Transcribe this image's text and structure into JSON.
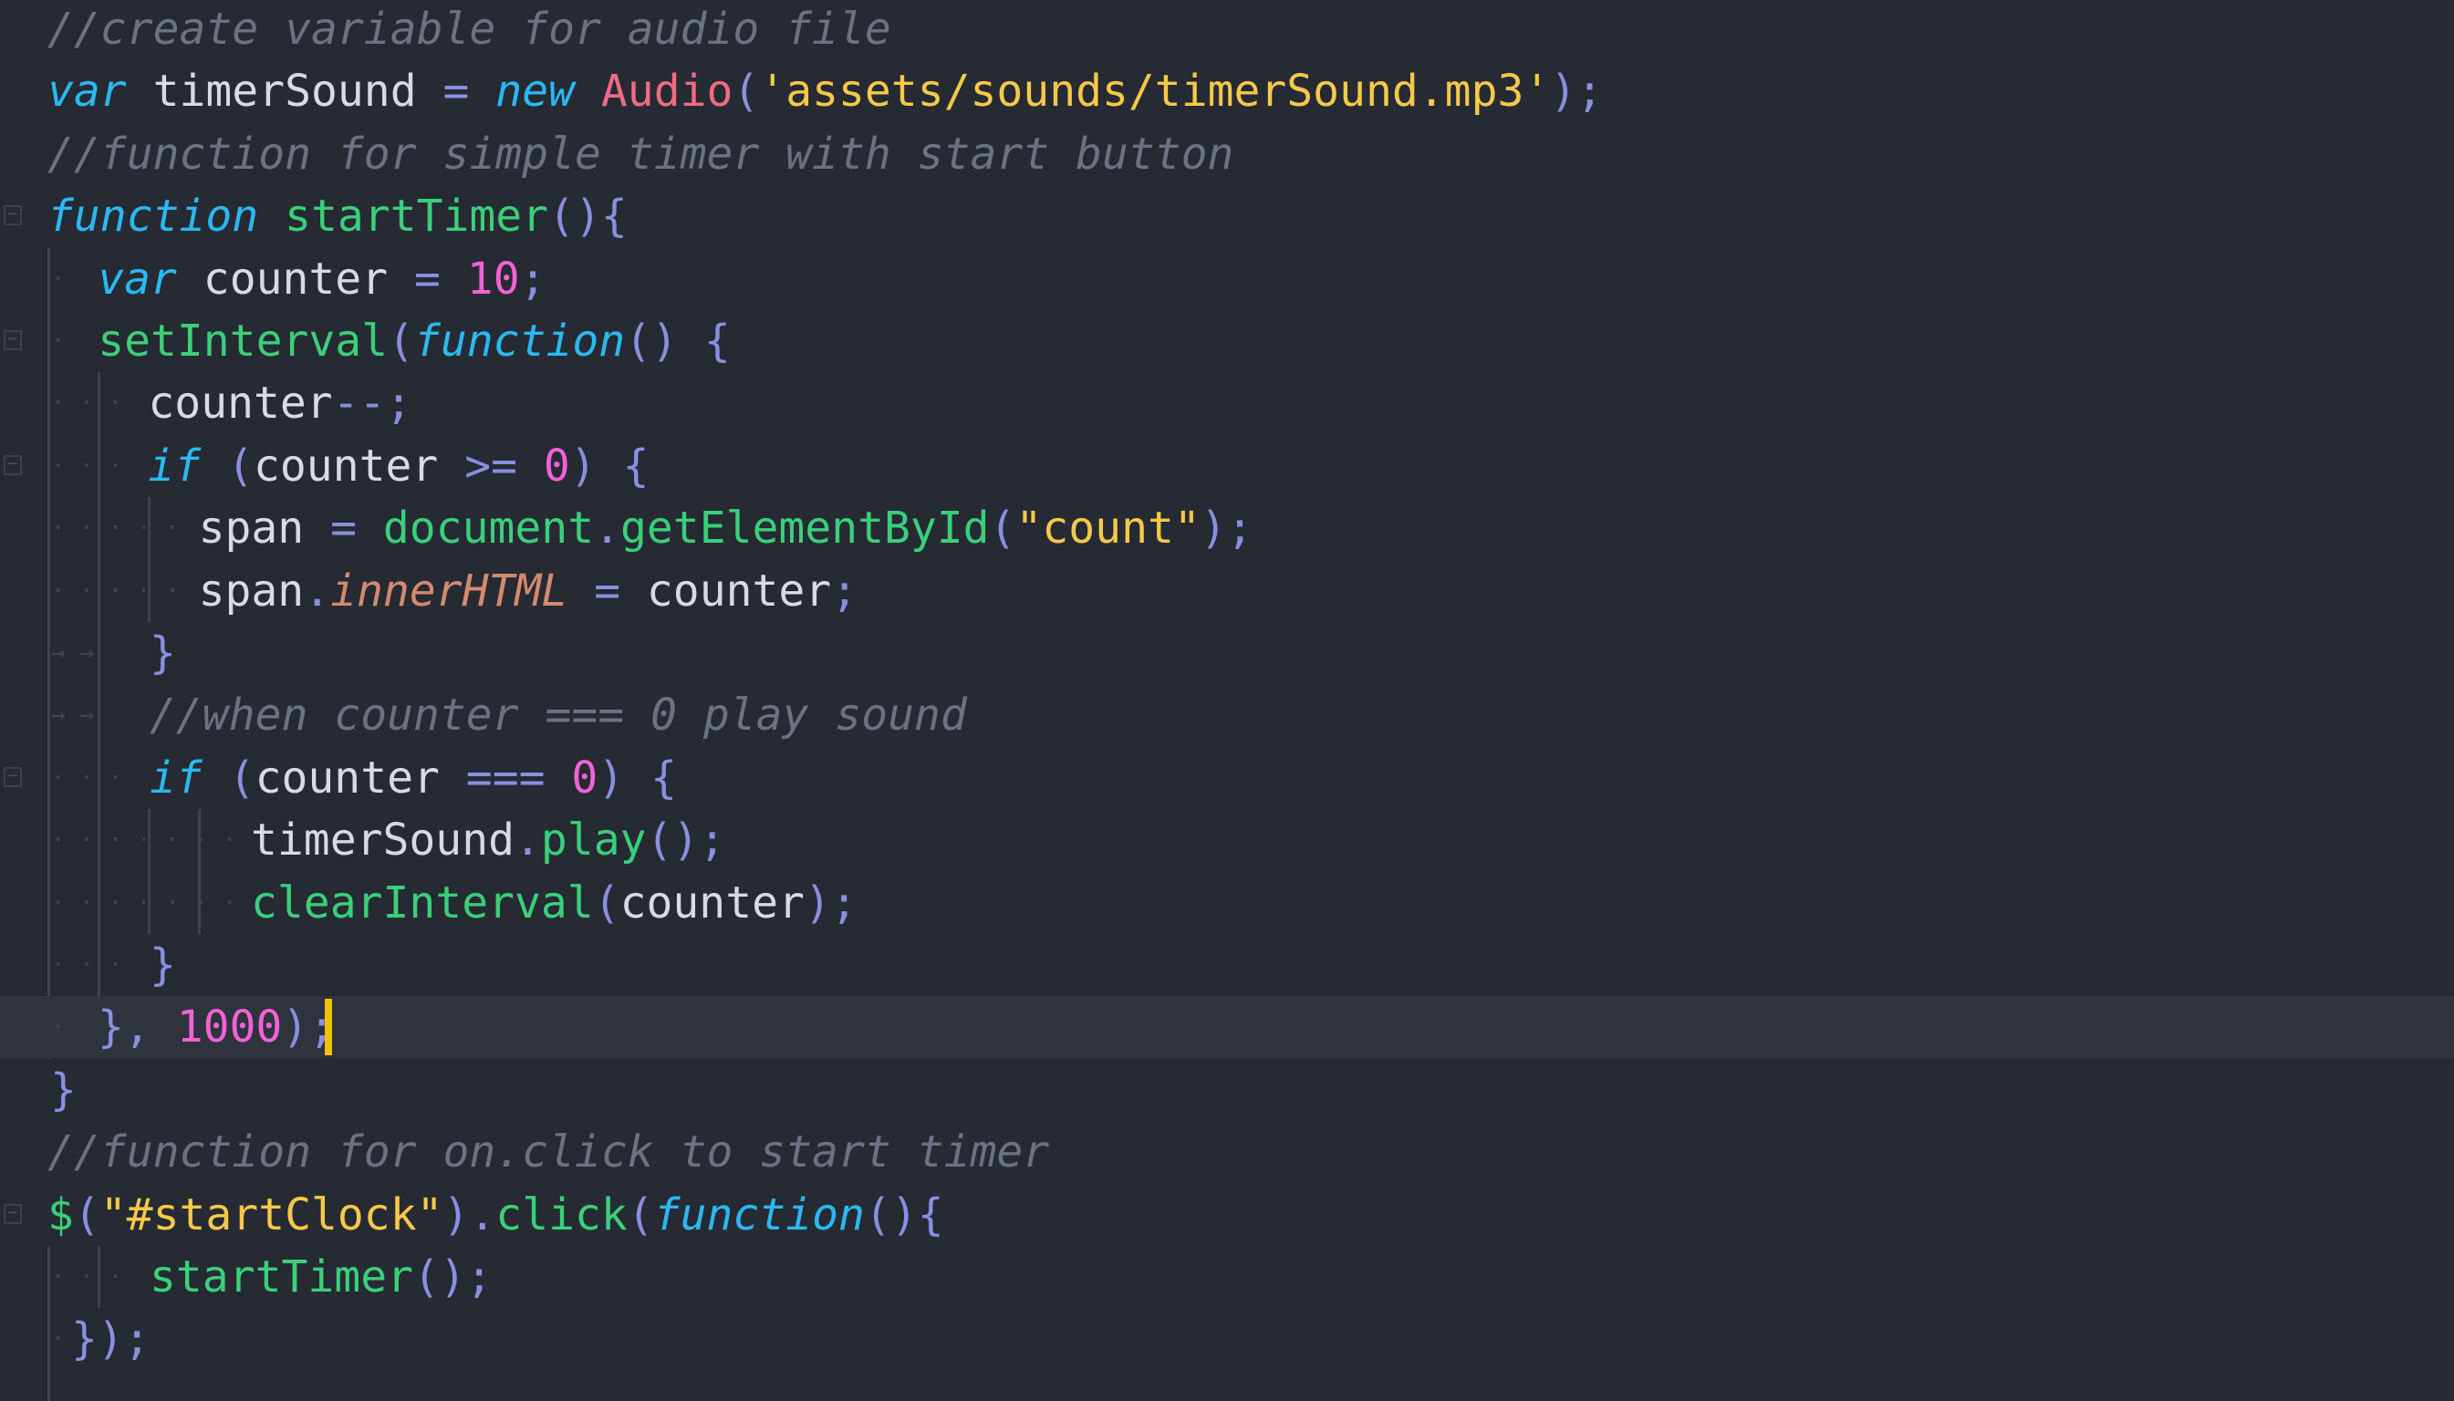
{
  "editor": {
    "language": "javascript",
    "theme_colors": {
      "background": "#262a33",
      "active_line": "#2e333d",
      "comment": "#6b7282",
      "keyword": "#2ab9f2",
      "function": "#3ad07a",
      "string": "#f7c948",
      "class": "#f16b84",
      "number": "#f262d6",
      "punctuation": "#8a8fe0",
      "property": "#d38a6f",
      "caret": "#f2c100"
    },
    "lines": [
      {
        "t": [
          [
            "cmt",
            "//create variable for audio file"
          ]
        ]
      },
      {
        "t": [
          [
            "kw",
            "var"
          ],
          [
            "id",
            " timerSound "
          ],
          [
            "op",
            "="
          ],
          [
            "id",
            " "
          ],
          [
            "kw",
            "new"
          ],
          [
            "id",
            " "
          ],
          [
            "cls",
            "Audio"
          ],
          [
            "pun",
            "("
          ],
          [
            "str",
            "'assets/sounds/timerSound.mp3'"
          ],
          [
            "pun",
            ");"
          ]
        ]
      },
      {
        "t": [
          [
            "cmt",
            "//function for simple timer with start button"
          ]
        ]
      },
      {
        "t": [
          [
            "kw",
            "function"
          ],
          [
            "id",
            " "
          ],
          [
            "fn",
            "startTimer"
          ],
          [
            "pun",
            "(){"
          ]
        ]
      },
      {
        "t": [
          [
            "kw",
            "var"
          ],
          [
            "id",
            " counter "
          ],
          [
            "op",
            "="
          ],
          [
            "id",
            " "
          ],
          [
            "num",
            "10"
          ],
          [
            "pun",
            ";"
          ]
        ]
      },
      {
        "t": [
          [
            "fn",
            "setInterval"
          ],
          [
            "pun",
            "("
          ],
          [
            "kw",
            "function"
          ],
          [
            "pun",
            "()"
          ],
          [
            "id",
            " "
          ],
          [
            "pun",
            "{"
          ]
        ]
      },
      {
        "t": [
          [
            "id",
            "counter"
          ],
          [
            "op",
            "--;"
          ]
        ]
      },
      {
        "t": [
          [
            "kw",
            "if"
          ],
          [
            "id",
            " "
          ],
          [
            "pun",
            "("
          ],
          [
            "id",
            "counter "
          ],
          [
            "op",
            ">="
          ],
          [
            "id",
            " "
          ],
          [
            "num",
            "0"
          ],
          [
            "pun",
            ")"
          ],
          [
            "id",
            " "
          ],
          [
            "pun",
            "{"
          ]
        ]
      },
      {
        "t": [
          [
            "id",
            "span "
          ],
          [
            "op",
            "="
          ],
          [
            "id",
            " "
          ],
          [
            "fn",
            "document"
          ],
          [
            "pun",
            "."
          ],
          [
            "fn",
            "getElementById"
          ],
          [
            "pun",
            "("
          ],
          [
            "str",
            "\"count\""
          ],
          [
            "pun",
            ");"
          ]
        ]
      },
      {
        "t": [
          [
            "id",
            "span"
          ],
          [
            "pun",
            "."
          ],
          [
            "prop",
            "innerHTML"
          ],
          [
            "id",
            " "
          ],
          [
            "op",
            "="
          ],
          [
            "id",
            " counter"
          ],
          [
            "pun",
            ";"
          ]
        ]
      },
      {
        "t": [
          [
            "pun",
            "}"
          ]
        ]
      },
      {
        "t": [
          [
            "cmt",
            "//when counter === 0 play sound"
          ]
        ]
      },
      {
        "t": [
          [
            "kw",
            "if"
          ],
          [
            "id",
            " "
          ],
          [
            "pun",
            "("
          ],
          [
            "id",
            "counter "
          ],
          [
            "op",
            "==="
          ],
          [
            "id",
            " "
          ],
          [
            "num",
            "0"
          ],
          [
            "pun",
            ")"
          ],
          [
            "id",
            " "
          ],
          [
            "pun",
            "{"
          ]
        ]
      },
      {
        "t": [
          [
            "id",
            "timerSound"
          ],
          [
            "pun",
            "."
          ],
          [
            "fn",
            "play"
          ],
          [
            "pun",
            "();"
          ]
        ]
      },
      {
        "t": [
          [
            "fn",
            "clearInterval"
          ],
          [
            "pun",
            "("
          ],
          [
            "id",
            "counter"
          ],
          [
            "pun",
            ");"
          ]
        ]
      },
      {
        "t": [
          [
            "pun",
            "}"
          ]
        ]
      },
      {
        "t": [
          [
            "pun",
            "},"
          ],
          [
            "id",
            " "
          ],
          [
            "num",
            "1000"
          ],
          [
            "pun",
            ");"
          ]
        ]
      },
      {
        "t": [
          [
            "pun",
            "}"
          ]
        ]
      },
      {
        "t": [
          [
            "cmt",
            "//function for on.click to start timer"
          ]
        ]
      },
      {
        "t": [
          [
            "fn",
            "$"
          ],
          [
            "pun",
            "("
          ],
          [
            "str",
            "\"#startClock\""
          ],
          [
            "pun",
            ")."
          ],
          [
            "fn",
            "click"
          ],
          [
            "pun",
            "("
          ],
          [
            "kw",
            "function"
          ],
          [
            "pun",
            "(){"
          ]
        ]
      },
      {
        "t": [
          [
            "fn",
            "startTimer"
          ],
          [
            "pun",
            "();"
          ]
        ]
      },
      {
        "t": [
          [
            "pun",
            "});"
          ]
        ]
      }
    ]
  }
}
